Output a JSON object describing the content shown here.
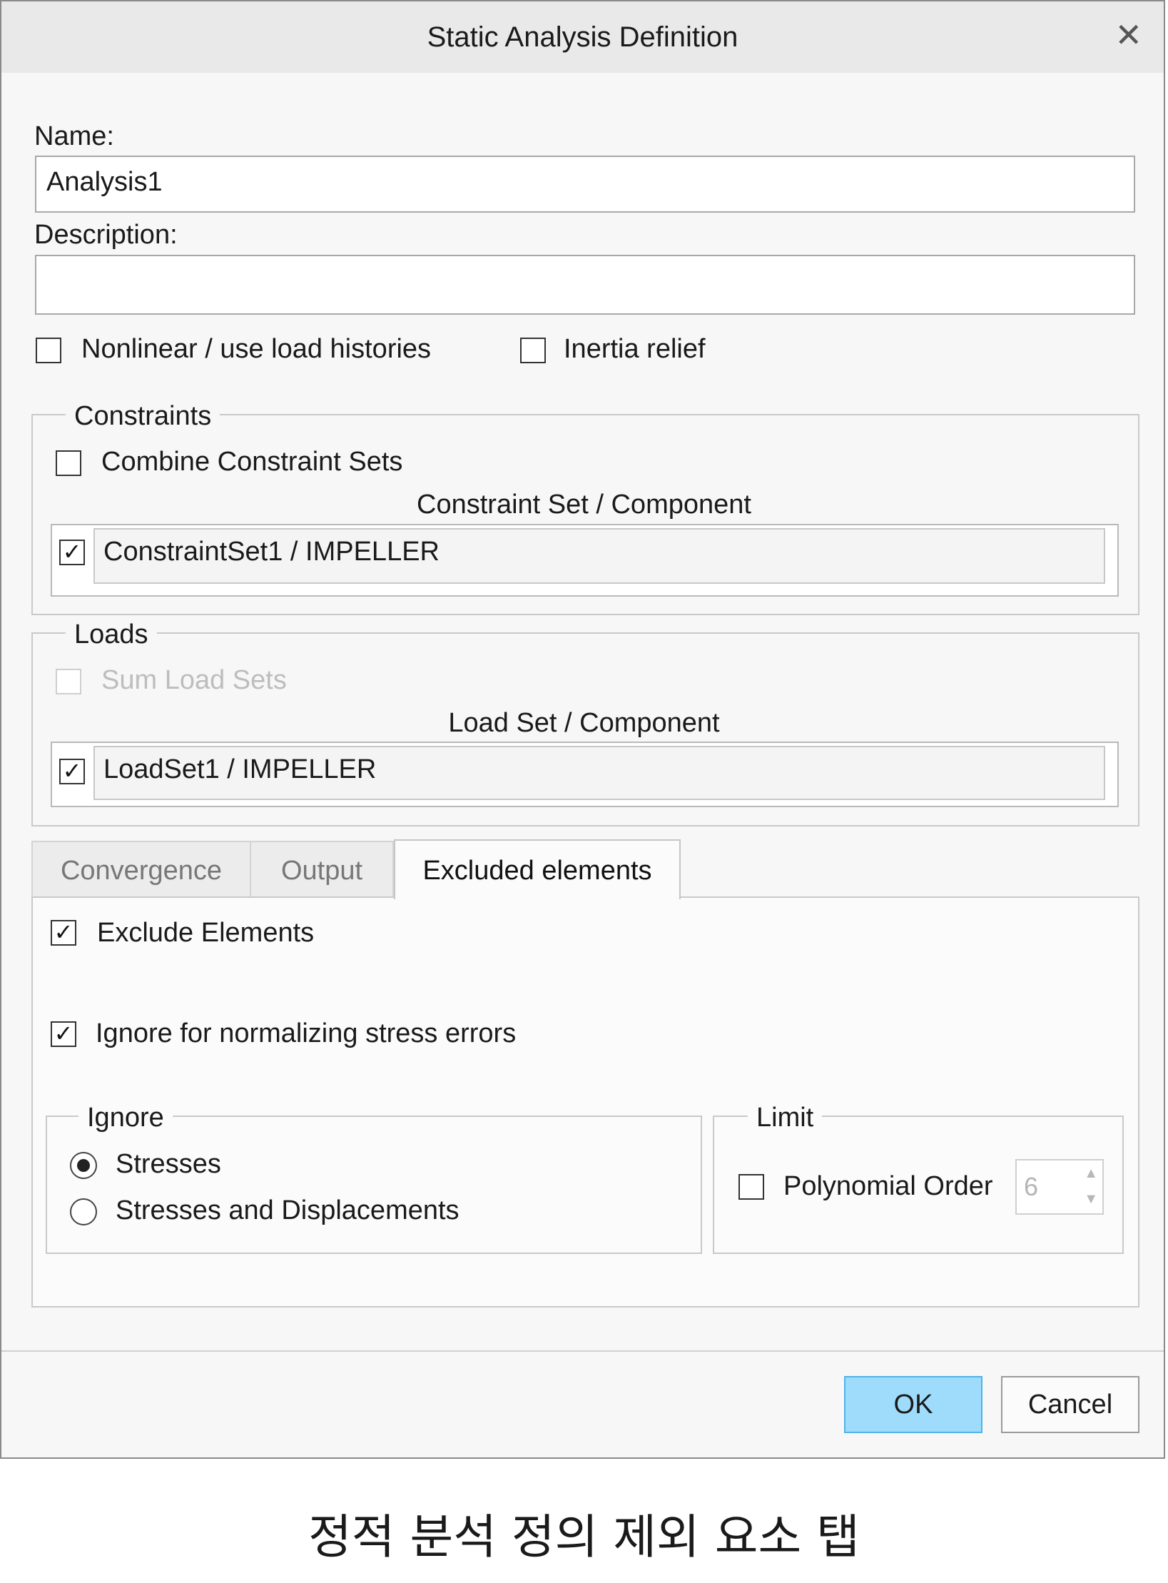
{
  "dialog": {
    "title": "Static Analysis Definition",
    "close_glyph": "✕"
  },
  "name": {
    "label": "Name:",
    "value": "Analysis1"
  },
  "description": {
    "label": "Description:",
    "value": ""
  },
  "options": {
    "nonlinear": {
      "label": "Nonlinear / use load histories",
      "checked": false
    },
    "inertia": {
      "label": "Inertia relief",
      "checked": false
    }
  },
  "constraints": {
    "group_label": "Constraints",
    "combine_label": "Combine Constraint Sets",
    "column_header": "Constraint Set / Component",
    "item": "ConstraintSet1 / IMPELLER",
    "check_glyph": "✓"
  },
  "loads": {
    "group_label": "Loads",
    "sum_label": "Sum Load Sets",
    "column_header": "Load Set / Component",
    "item": "LoadSet1 / IMPELLER",
    "check_glyph": "✓"
  },
  "tabs": [
    {
      "label": "Convergence",
      "active": false
    },
    {
      "label": "Output",
      "active": false
    },
    {
      "label": "Excluded elements",
      "active": true
    }
  ],
  "excluded": {
    "exclude_label": "Exclude Elements",
    "ignore_norm_label": "Ignore for normalizing stress errors",
    "check_glyph": "✓",
    "ignore_group": {
      "label": "Ignore",
      "radio_stresses": "Stresses",
      "radio_both": "Stresses and Displacements",
      "selected": "Stresses"
    },
    "limit_group": {
      "label": "Limit",
      "polynomial_label": "Polynomial Order",
      "polynomial_value": "6"
    }
  },
  "buttons": {
    "ok": "OK",
    "cancel": "Cancel"
  },
  "caption": "정적 분석 정의 제외 요소 탭",
  "colors": {
    "ok_bg": "#9fdcfb",
    "ok_border": "#4fb3e8",
    "titlebar": "#e9e9e9"
  }
}
